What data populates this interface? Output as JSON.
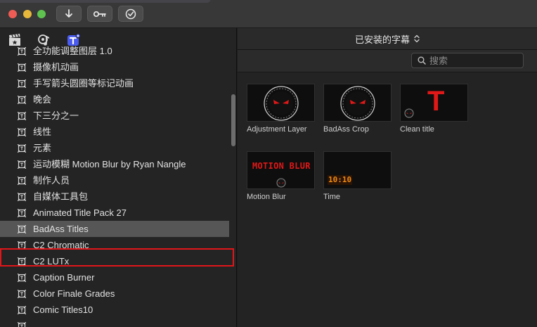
{
  "toolbar": {
    "buttons": [
      {
        "name": "import-button",
        "icon": "download-arrow-icon"
      },
      {
        "name": "keyword-button",
        "icon": "key-icon"
      },
      {
        "name": "background-tasks-button",
        "icon": "checkmark-circle-icon"
      }
    ]
  },
  "sidebar": {
    "items": [
      {
        "label": "全功能调整图层 1.0"
      },
      {
        "label": "摄像机动画"
      },
      {
        "label": "手写箭头圆圈等标记动画"
      },
      {
        "label": "晚会"
      },
      {
        "label": "下三分之一"
      },
      {
        "label": "线性"
      },
      {
        "label": "元素"
      },
      {
        "label": "运动模糊 Motion Blur by Ryan Nangle"
      },
      {
        "label": "制作人员"
      },
      {
        "label": "自媒体工具包"
      },
      {
        "label": "Animated Title Pack 27"
      },
      {
        "label": "BadAss Titles"
      },
      {
        "label": "C2 Chromatic"
      },
      {
        "label": "C2 LUTx"
      },
      {
        "label": "Caption Burner"
      },
      {
        "label": "Color Finale Grades"
      },
      {
        "label": "Comic Titles10"
      },
      {
        "label": "…"
      }
    ],
    "selected_index": 11
  },
  "browser": {
    "dropdown_label": "已安装的字幕",
    "search_placeholder": "搜索",
    "tiles": [
      {
        "label": "Adjustment Layer",
        "thumb": "skull"
      },
      {
        "label": "BadAss Crop",
        "thumb": "skull"
      },
      {
        "label": "Clean title",
        "thumb": "letter-t",
        "thumb_text": "T"
      },
      {
        "label": "Motion Blur",
        "thumb": "motion-blur",
        "thumb_text": "MOTION BLUR"
      },
      {
        "label": "Time",
        "thumb": "time",
        "thumb_text": "10:10"
      }
    ]
  },
  "colors": {
    "accent_red": "#e0161a",
    "selected_row": "#565656",
    "titles_icon_blue": "#4a5cf0"
  }
}
